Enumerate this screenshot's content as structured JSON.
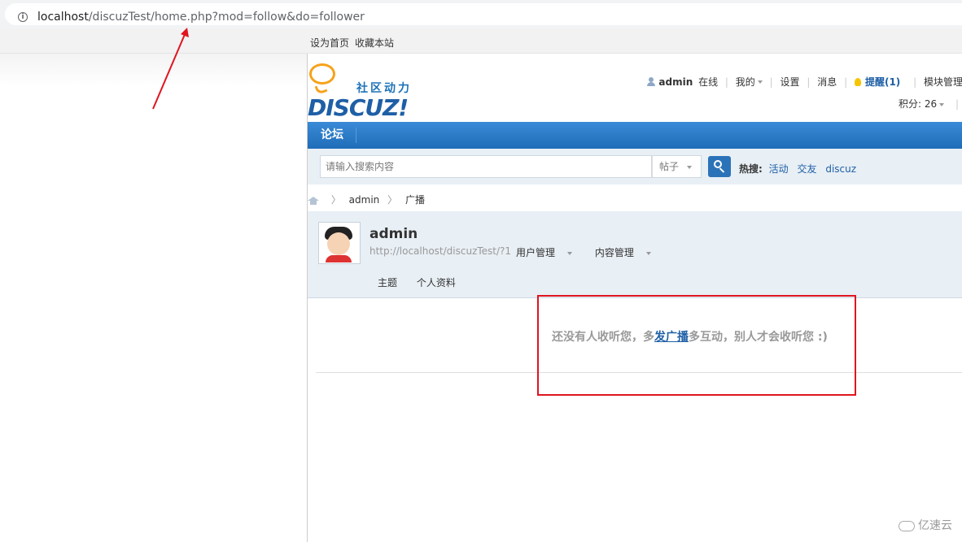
{
  "browser": {
    "url_host": "localhost",
    "url_path": "/discuzTest/home.php?mod=follow&do=follower"
  },
  "toptb": {
    "set_home": "设为首页",
    "bookmark": "收藏本站"
  },
  "logo": {
    "subtitle": "社区动力",
    "main": "DISCUZ!"
  },
  "userbar": {
    "username": "admin",
    "online": "在线",
    "mine": "我的",
    "settings": "设置",
    "messages": "消息",
    "remind": "提醒(1)",
    "module_manage": "模块管理",
    "score": "积分: 26"
  },
  "nav": {
    "forum": "论坛"
  },
  "search": {
    "placeholder": "请输入搜索内容",
    "type": "帖子",
    "hot_label": "热搜:",
    "hot_items": [
      "活动",
      "交友",
      "discuz"
    ]
  },
  "breadcrumb": {
    "user": "admin",
    "current": "广播"
  },
  "profile": {
    "name": "admin",
    "url": "http://localhost/discuzTest/?1",
    "user_manage": "用户管理",
    "content_manage": "内容管理",
    "tab_topics": "主题",
    "tab_profile": "个人资料"
  },
  "empty": {
    "prefix": "还没有人收听您，多",
    "link": "发广播",
    "suffix": "多互动，别人才会收听您 :)"
  },
  "watermark": "亿速云",
  "colors": {
    "nav_blue": "#1f6db8",
    "annotation_red": "#e0141f",
    "link_blue": "#1e5fa6"
  }
}
